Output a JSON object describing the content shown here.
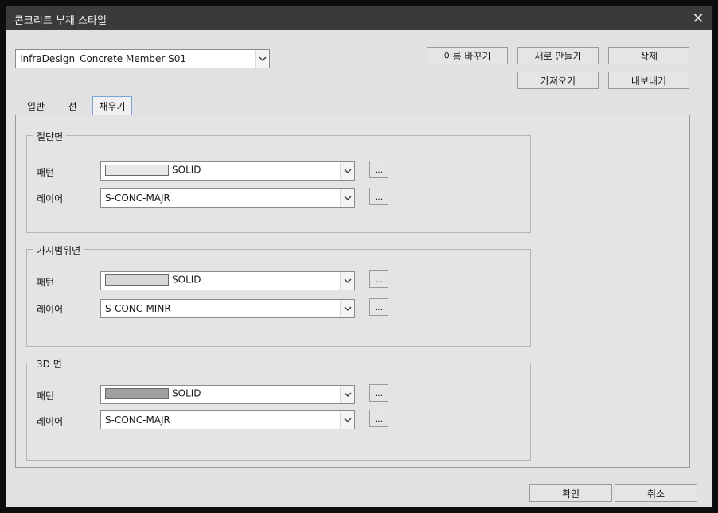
{
  "window": {
    "title": "콘크리트 부재 스타일"
  },
  "style_select": {
    "value": "InfraDesign_Concrete Member S01"
  },
  "buttons": {
    "rename": "이름 바꾸기",
    "new": "새로 만들기",
    "delete": "삭제",
    "import": "가져오기",
    "export": "내보내기",
    "ok": "확인",
    "cancel": "취소"
  },
  "tabs": [
    {
      "label": "일반",
      "active": false
    },
    {
      "label": "선",
      "active": false
    },
    {
      "label": "채우기",
      "active": true
    }
  ],
  "groups": [
    {
      "title": "절단면",
      "pattern_label": "패턴",
      "pattern_value": "SOLID",
      "pattern_color": "#e8e8e8",
      "layer_label": "레이어",
      "layer_value": "S-CONC-MAJR",
      "more": "..."
    },
    {
      "title": "가시범위면",
      "pattern_label": "패턴",
      "pattern_value": "SOLID",
      "pattern_color": "#d6d6d6",
      "layer_label": "레이어",
      "layer_value": "S-CONC-MINR",
      "more": "..."
    },
    {
      "title": "3D 면",
      "pattern_label": "패턴",
      "pattern_value": "SOLID",
      "pattern_color": "#a0a0a0",
      "layer_label": "레이어",
      "layer_value": "S-CONC-MAJR",
      "more": "..."
    }
  ]
}
